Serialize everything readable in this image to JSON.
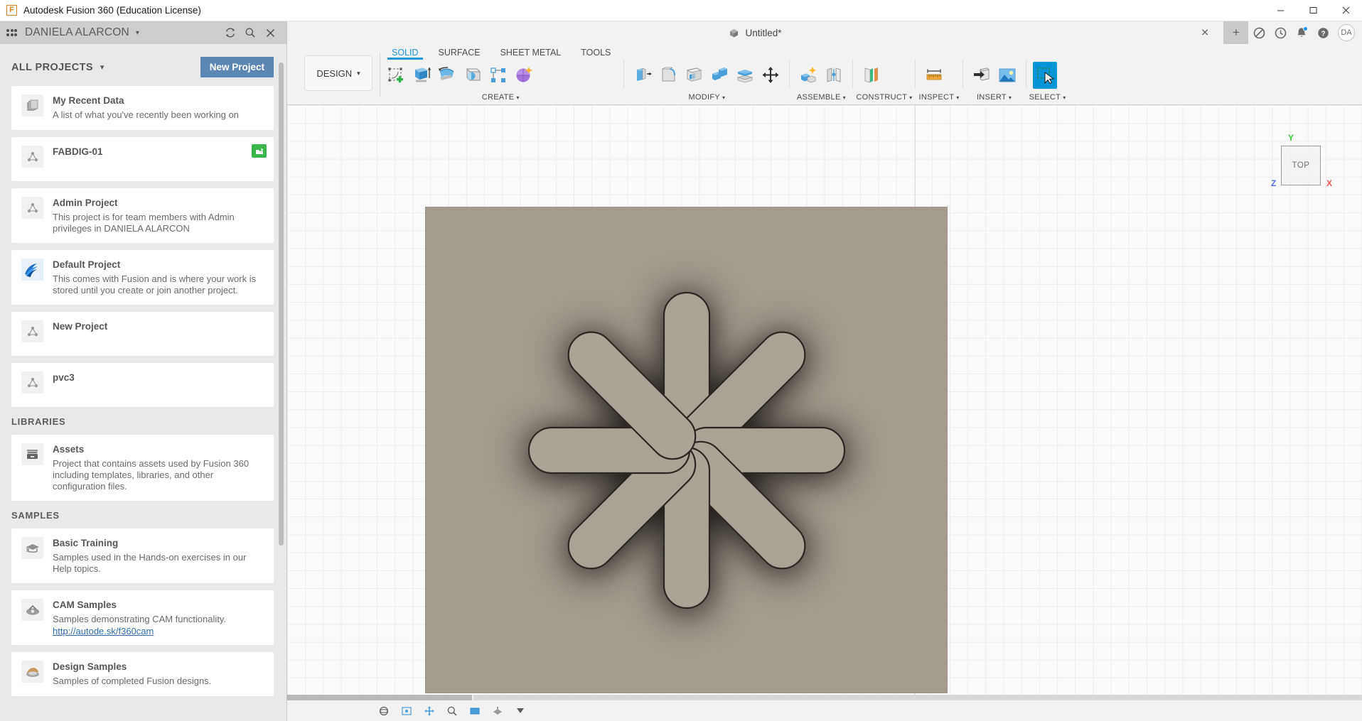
{
  "window": {
    "app_title": "Autodesk Fusion 360 (Education License)",
    "logo_letter": "F",
    "minimize": "–",
    "maximize": "☐",
    "close": "✕"
  },
  "data_panel": {
    "user_name": "DANIELA ALARCON",
    "user_caret": "▾",
    "header_icons": [
      {
        "name": "refresh-icon",
        "glyph": "↻"
      },
      {
        "name": "search-icon",
        "glyph": "⌕"
      },
      {
        "name": "close-panel-icon",
        "glyph": "✕"
      }
    ],
    "all_projects_label": "ALL PROJECTS",
    "all_projects_caret": "▾",
    "new_project_button": "New Project",
    "projects": [
      {
        "title": "My Recent Data",
        "desc": "A list of what you've recently been working on",
        "icon": "documents-icon",
        "badge": false
      },
      {
        "title": "FABDIG-01",
        "desc": "",
        "icon": "project-triangle-icon",
        "badge": true
      },
      {
        "title": "Admin Project",
        "desc": "This project is for team members with Admin privileges in DANIELA ALARCON",
        "icon": "project-triangle-icon",
        "badge": false
      },
      {
        "title": "Default Project",
        "desc": "This comes with Fusion and is where your work is stored until you create or join another project.",
        "icon": "default-project-icon",
        "badge": false
      },
      {
        "title": "New Project",
        "desc": "",
        "icon": "project-triangle-icon",
        "badge": false
      },
      {
        "title": "pvc3",
        "desc": "",
        "icon": "project-triangle-icon",
        "badge": false
      }
    ],
    "libraries_label": "LIBRARIES",
    "libraries": [
      {
        "title": "Assets",
        "desc": "Project that contains assets used by Fusion 360 including templates, libraries, and other configuration files.",
        "icon": "assets-box-icon"
      }
    ],
    "samples_label": "SAMPLES",
    "samples": [
      {
        "title": "Basic Training",
        "desc": "Samples used in the Hands-on exercises in our Help topics.",
        "icon": "graduation-cap-icon",
        "link": ""
      },
      {
        "title": "CAM Samples",
        "desc": "Samples demonstrating CAM functionality.",
        "icon": "cam-samples-icon",
        "link": "http://autode.sk/f360cam"
      },
      {
        "title": "Design Samples",
        "desc": "Samples of completed Fusion designs.",
        "icon": "design-samples-icon",
        "link": ""
      }
    ]
  },
  "document_tabs": {
    "active_title": "Untitled*",
    "close_glyph": "✕",
    "add_glyph": "+",
    "icons": [
      {
        "name": "job-status-icon",
        "glyph": "⟳"
      },
      {
        "name": "recent-history-icon",
        "glyph": "◔"
      },
      {
        "name": "notifications-bell-icon",
        "glyph": "🔔"
      },
      {
        "name": "help-icon",
        "glyph": "?"
      }
    ],
    "avatar_initials": "DA"
  },
  "ribbon": {
    "workspace": "DESIGN",
    "workspace_caret": "▾",
    "tabs": [
      {
        "label": "SOLID",
        "active": true
      },
      {
        "label": "SURFACE",
        "active": false
      },
      {
        "label": "SHEET METAL",
        "active": false
      },
      {
        "label": "TOOLS",
        "active": false
      }
    ],
    "panels": [
      {
        "label": "CREATE",
        "caret": "▾",
        "tools": [
          "create-sketch-icon",
          "extrude-icon",
          "revolve-icon",
          "sweep-icon",
          "rectangular-pattern-icon",
          "create-form-icon"
        ]
      },
      {
        "label": "MODIFY",
        "caret": "▾",
        "tools": [
          "press-pull-icon",
          "fillet-icon",
          "shell-icon",
          "combine-icon",
          "offset-face-icon",
          "move-copy-icon"
        ]
      },
      {
        "label": "ASSEMBLE",
        "caret": "▾",
        "tools": [
          "new-component-icon",
          "joint-icon"
        ]
      },
      {
        "label": "CONSTRUCT",
        "caret": "▾",
        "tools": [
          "offset-plane-icon"
        ]
      },
      {
        "label": "INSPECT",
        "caret": "▾",
        "tools": [
          "measure-icon"
        ]
      },
      {
        "label": "INSERT",
        "caret": "▾",
        "tools": [
          "insert-derive-icon",
          "canvas-image-icon"
        ]
      },
      {
        "label": "SELECT",
        "caret": "▾",
        "tools": [
          "select-cursor-icon"
        ]
      }
    ]
  },
  "canvas": {
    "view_cube_face": "TOP",
    "axis_x": "X",
    "axis_y": "Y",
    "axis_z": "Z",
    "model_color": "#a39c8f",
    "accent_color": "#0696d7"
  },
  "bottom_bar": {
    "nav_icons": [
      "orbit-icon",
      "look-at-icon",
      "pan-icon",
      "zoom-icon",
      "display-settings-icon",
      "grid-snap-icon",
      "viewports-icon"
    ]
  }
}
